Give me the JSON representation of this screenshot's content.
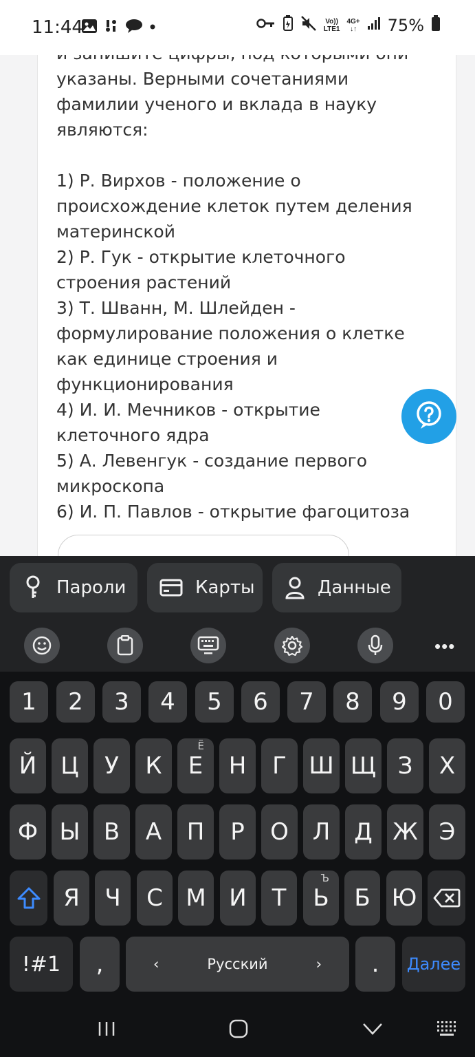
{
  "status_bar": {
    "time": "11:44",
    "battery": "75%",
    "volte_top": "Vo))",
    "volte_bottom": "LTE1",
    "network": "4G+",
    "left_icons": [
      "gallery-icon",
      "voicemail-icon",
      "chat-icon",
      "dot-icon"
    ],
    "right_icons": [
      "key-icon",
      "battery-saver-icon",
      "mute-icon",
      "signal-icon",
      "battery-icon"
    ]
  },
  "page": {
    "question_intro": "и запишите цифры, под которыми они указаны. Верными сочетаниями фамилии ученого и вклада в науку являются:",
    "options": [
      "1) Р. Вирхов - положение о происхождение клеток путем деления материнской",
      "2) Р. Гук - открытие клеточного строения растений",
      "3) Т. Шванн, М. Шлейден - формулирование положения о клетке как единице строения и функционирования",
      "4) И. И. Мечников - открытие клеточного ядра",
      "5) А. Левенгук - создание первого микроскопа",
      "6) И. П. Павлов - открытие фагоцитоза"
    ],
    "help_icon": "question-icon",
    "accent_color": "#22a0e6"
  },
  "autofill": {
    "passwords": "Пароли",
    "cards": "Карты",
    "data": "Данные"
  },
  "toolbar": {
    "icons": [
      "emoji-icon",
      "clipboard-icon",
      "keyboard-icon",
      "settings-icon",
      "mic-icon"
    ],
    "more": "•••"
  },
  "keyboard": {
    "numbers": [
      "1",
      "2",
      "3",
      "4",
      "5",
      "6",
      "7",
      "8",
      "9",
      "0"
    ],
    "row1": [
      "Й",
      "Ц",
      "У",
      "К",
      "Е",
      "Н",
      "Г",
      "Ш",
      "Щ",
      "З",
      "Х"
    ],
    "row1_hint_e": "Ё",
    "row2": [
      "Ф",
      "Ы",
      "В",
      "А",
      "П",
      "Р",
      "О",
      "Л",
      "Д",
      "Ж",
      "Э"
    ],
    "row3": [
      "Я",
      "Ч",
      "С",
      "М",
      "И",
      "Т",
      "Ь",
      "Б",
      "Ю"
    ],
    "row3_hint_soft": "Ъ",
    "symbols": "!#1",
    "comma": ",",
    "language": "Русский",
    "left_arrow": "‹",
    "right_arrow": "›",
    "period": ".",
    "action": "Далее",
    "action_color": "#3d8bff"
  },
  "navbar": {
    "icons": [
      "recent-apps-icon",
      "home-icon",
      "back-icon",
      "keyboard-switch-icon"
    ]
  }
}
